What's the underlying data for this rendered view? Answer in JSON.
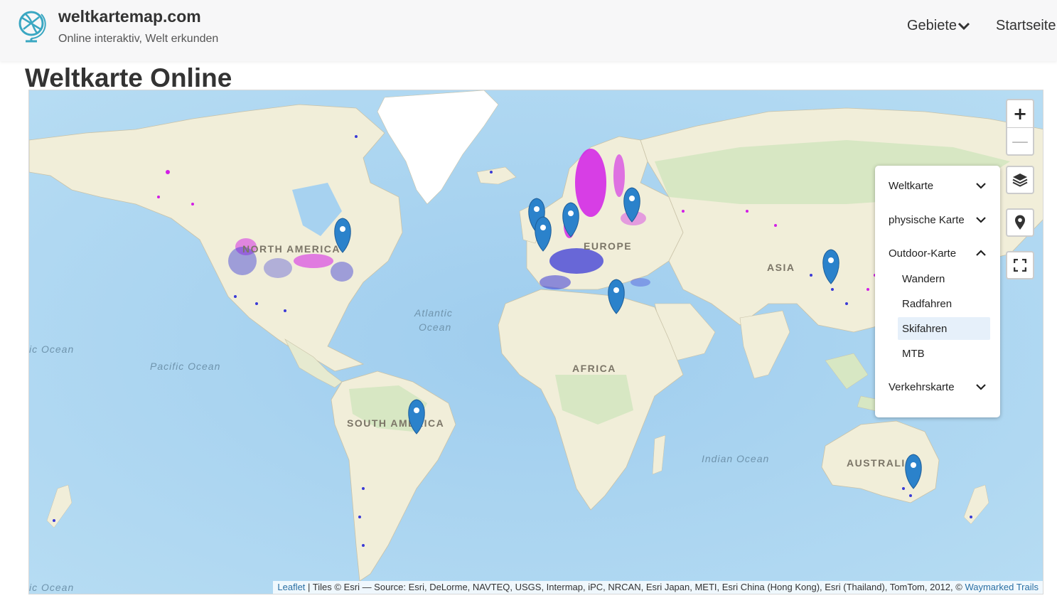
{
  "header": {
    "site_name": "weltkartemap.com",
    "tagline": "Online interaktiv, Welt erkunden",
    "nav": {
      "gebiete": "Gebiete",
      "startseite": "Startseite"
    }
  },
  "page": {
    "title": "Weltkarte Online"
  },
  "map": {
    "labels": {
      "north_america": "NORTH AMERICA",
      "south_america": "SOUTH AMERICA",
      "europe": "EUROPE",
      "africa": "AFRICA",
      "asia": "ASIA",
      "australia": "AUSTRALIA",
      "atlantic_1": "Atlantic",
      "atlantic_2": "Ocean",
      "pacific": "Pacific Ocean",
      "indian": "Indian Ocean",
      "ocean_left_top": "ic Ocean",
      "ocean_left_bottom": "ic Ocean"
    },
    "colors": {
      "ocean": "#aad3f0",
      "land": "#f1eed9",
      "forest": "#d7e7c3",
      "ice": "#ffffff",
      "marker": "#2b82cb",
      "route_magenta": "#d21ee6",
      "route_blue": "#3a3ad6"
    },
    "zoom_in": "+",
    "zoom_out": "—",
    "layers": {
      "weltkarte": "Weltkarte",
      "physische": "physische Karte",
      "outdoor": "Outdoor-Karte",
      "outdoor_items": [
        "Wandern",
        "Radfahren",
        "Skifahren",
        "MTB"
      ],
      "verkehr": "Verkehrskarte"
    },
    "attribution": {
      "leaflet": "Leaflet",
      "text": " | Tiles © Esri — Source: Esri, DeLorme, NAVTEQ, USGS, Intermap, iPC, NRCAN, Esri Japan, METI, Esri China (Hong Kong), Esri (Thailand), TomTom, 2012, © ",
      "waymarked": "Waymarked Trails"
    }
  }
}
